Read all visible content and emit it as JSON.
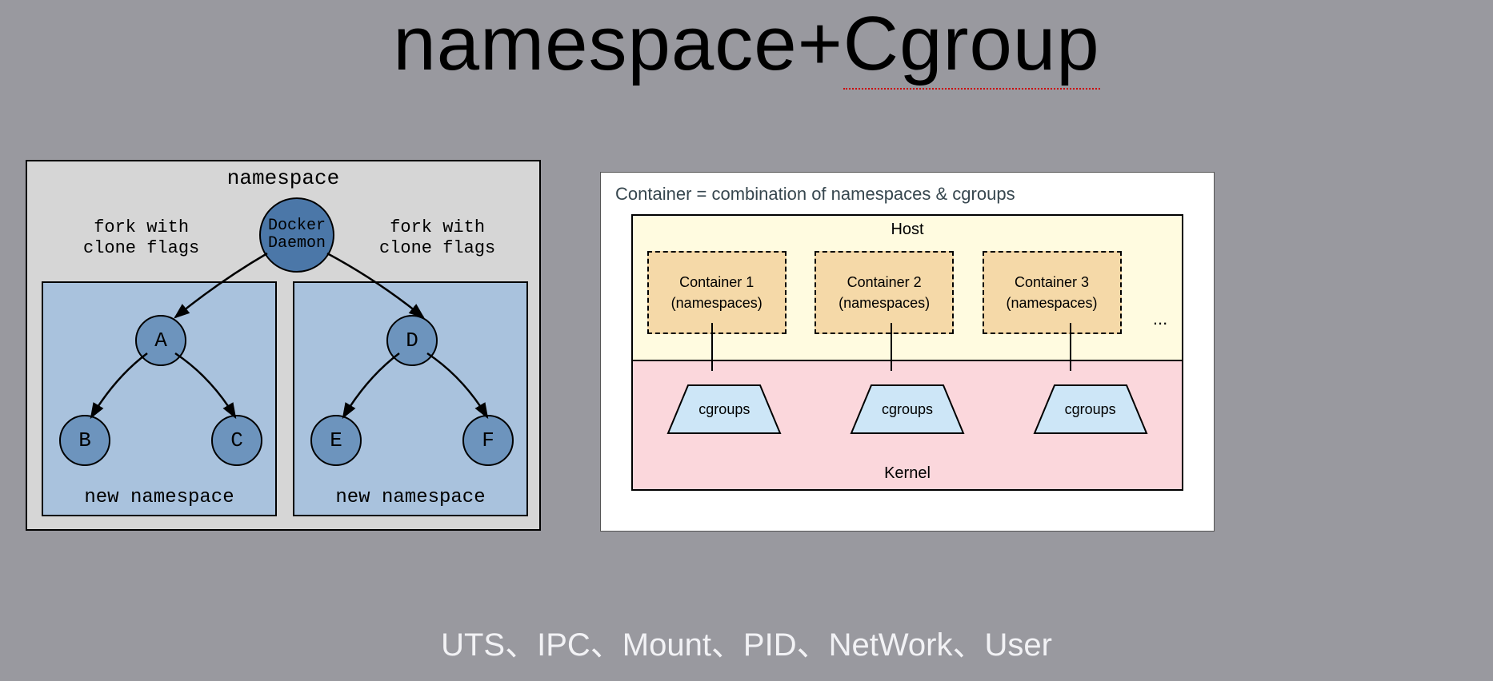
{
  "title_prefix": "namespace+",
  "title_underlined": "Cgroup",
  "footer": "UTS、IPC、Mount、PID、NetWork、User",
  "left": {
    "outer_title": "namespace",
    "docker_line1": "Docker",
    "docker_line2": "Daemon",
    "fork_left_l1": "fork with",
    "fork_left_l2": "clone flags",
    "fork_right_l1": "fork with",
    "fork_right_l2": "clone flags",
    "sub_left_title": "new namespace",
    "sub_right_title": "new namespace",
    "nodes": {
      "A": "A",
      "B": "B",
      "C": "C",
      "D": "D",
      "E": "E",
      "F": "F"
    }
  },
  "right": {
    "heading": "Container = combination of namespaces & cgroups",
    "host_label": "Host",
    "kernel_label": "Kernel",
    "containers": [
      {
        "name": "Container 1",
        "sub": "(namespaces)"
      },
      {
        "name": "Container 2",
        "sub": "(namespaces)"
      },
      {
        "name": "Container 3",
        "sub": "(namespaces)"
      }
    ],
    "ellipsis": "...",
    "cgroup_label": "cgroups"
  }
}
